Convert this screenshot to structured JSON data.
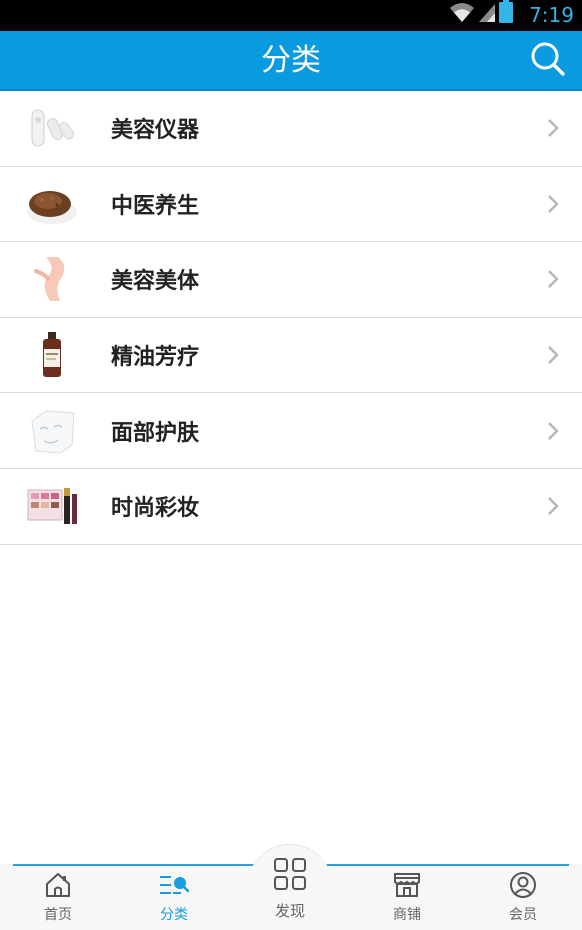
{
  "status_bar": {
    "time": "7:19",
    "icons": [
      "wifi-icon",
      "signal-icon",
      "battery-icon"
    ]
  },
  "header": {
    "title": "分类",
    "search_icon": "search-icon"
  },
  "categories": [
    {
      "label": "美容仪器",
      "icon": "beauty-device-icon"
    },
    {
      "label": "中医养生",
      "icon": "herbal-seeds-icon"
    },
    {
      "label": "美容美体",
      "icon": "body-care-icon"
    },
    {
      "label": "精油芳疗",
      "icon": "essential-oil-icon"
    },
    {
      "label": "面部护肤",
      "icon": "face-mask-icon"
    },
    {
      "label": "时尚彩妆",
      "icon": "makeup-icon"
    }
  ],
  "bottom_nav": {
    "items": [
      {
        "label": "首页",
        "icon": "home-icon",
        "active": false
      },
      {
        "label": "分类",
        "icon": "category-icon",
        "active": true
      },
      {
        "label": "发现",
        "icon": "discover-grid-icon",
        "active": false
      },
      {
        "label": "商铺",
        "icon": "store-icon",
        "active": false
      },
      {
        "label": "会员",
        "icon": "member-icon",
        "active": false
      }
    ]
  },
  "colors": {
    "header_bg": "#0a9ae0",
    "status_time": "#33b5e5",
    "nav_active": "#1b9be0",
    "text_primary": "#222222",
    "chevron": "#b5b5b5"
  }
}
